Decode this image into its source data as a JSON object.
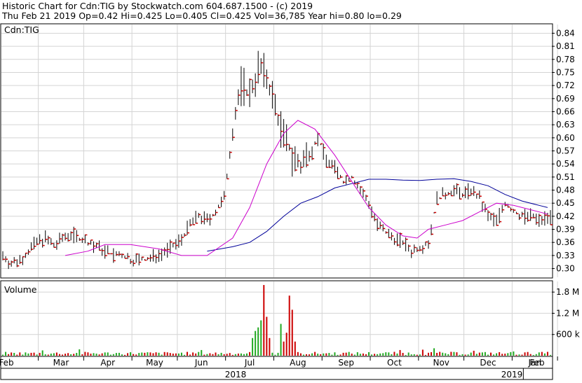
{
  "header": {
    "line1": "Historic Chart for Cdn:TIG by Stockwatch.com 604.687.1500 - (c) 2019",
    "line2": "Thu Feb 21 2019  Op=0.42  Hi=0.425  Lo=0.405  Cl=0.425  Vol=36,785  Year hi=0.80  lo=0.29"
  },
  "colors": {
    "price_bar": "#000000",
    "close_tick": "#cc0000",
    "ma_short": "#cc00cc",
    "ma_long": "#000099",
    "grid": "#d4d4d4",
    "volume_up": "#22aa22",
    "volume_down": "#cc0000",
    "frame": "#000000"
  },
  "chart_data": [
    {
      "type": "line",
      "name": "price-panel",
      "label": "Cdn:TIG",
      "ylim": [
        0.28,
        0.86
      ],
      "yticks": [
        "0.84",
        "0.81",
        "0.78",
        "0.75",
        "0.72",
        "0.69",
        "0.66",
        "0.63",
        "0.60",
        "0.57",
        "0.54",
        "0.51",
        "0.48",
        "0.45",
        "0.42",
        "0.39",
        "0.36",
        "0.33",
        "0.30"
      ],
      "grid": true,
      "x_months": [
        "Feb",
        "Mar",
        "Apr",
        "May",
        "Jun",
        "Jul",
        "Aug",
        "Sep",
        "Oct",
        "Nov",
        "Dec",
        "Jan",
        "Feb"
      ],
      "x_years": [
        "2018",
        "2019"
      ],
      "series": [],
      "close_path": [
        [
          0,
          0.33
        ],
        [
          3,
          0.31
        ],
        [
          6,
          0.32
        ],
        [
          9,
          0.34
        ],
        [
          12,
          0.36
        ],
        [
          15,
          0.37
        ],
        [
          18,
          0.35
        ],
        [
          21,
          0.37
        ],
        [
          24,
          0.38
        ],
        [
          27,
          0.37
        ],
        [
          30,
          0.36
        ],
        [
          33,
          0.35
        ],
        [
          36,
          0.34
        ],
        [
          39,
          0.33
        ],
        [
          42,
          0.33
        ],
        [
          45,
          0.32
        ],
        [
          48,
          0.32
        ],
        [
          51,
          0.32
        ],
        [
          54,
          0.33
        ],
        [
          57,
          0.34
        ],
        [
          60,
          0.35
        ],
        [
          63,
          0.37
        ],
        [
          66,
          0.4
        ],
        [
          69,
          0.42
        ],
        [
          72,
          0.41
        ],
        [
          75,
          0.43
        ],
        [
          78,
          0.46
        ],
        [
          81,
          0.62
        ],
        [
          84,
          0.72
        ],
        [
          87,
          0.7
        ],
        [
          90,
          0.76
        ],
        [
          93,
          0.74
        ],
        [
          96,
          0.67
        ],
        [
          99,
          0.6
        ],
        [
          102,
          0.56
        ],
        [
          105,
          0.53
        ],
        [
          108,
          0.57
        ],
        [
          111,
          0.6
        ],
        [
          114,
          0.55
        ],
        [
          117,
          0.53
        ],
        [
          120,
          0.5
        ],
        [
          123,
          0.51
        ],
        [
          126,
          0.48
        ],
        [
          129,
          0.45
        ],
        [
          132,
          0.4
        ],
        [
          135,
          0.38
        ],
        [
          138,
          0.37
        ],
        [
          141,
          0.36
        ],
        [
          144,
          0.34
        ],
        [
          147,
          0.35
        ],
        [
          150,
          0.36
        ],
        [
          153,
          0.46
        ],
        [
          156,
          0.47
        ],
        [
          159,
          0.48
        ],
        [
          162,
          0.47
        ],
        [
          165,
          0.48
        ],
        [
          168,
          0.46
        ],
        [
          171,
          0.42
        ],
        [
          174,
          0.41
        ],
        [
          177,
          0.45
        ],
        [
          180,
          0.43
        ],
        [
          183,
          0.42
        ],
        [
          186,
          0.42
        ],
        [
          189,
          0.41
        ],
        [
          192,
          0.42
        ]
      ],
      "ma_short": [
        [
          22,
          0.33
        ],
        [
          30,
          0.34
        ],
        [
          36,
          0.355
        ],
        [
          45,
          0.355
        ],
        [
          55,
          0.345
        ],
        [
          63,
          0.33
        ],
        [
          72,
          0.33
        ],
        [
          81,
          0.37
        ],
        [
          87,
          0.44
        ],
        [
          93,
          0.54
        ],
        [
          99,
          0.61
        ],
        [
          104,
          0.64
        ],
        [
          110,
          0.62
        ],
        [
          117,
          0.56
        ],
        [
          123,
          0.5
        ],
        [
          129,
          0.44
        ],
        [
          135,
          0.4
        ],
        [
          141,
          0.375
        ],
        [
          146,
          0.37
        ],
        [
          150,
          0.39
        ],
        [
          156,
          0.4
        ],
        [
          162,
          0.41
        ],
        [
          168,
          0.43
        ],
        [
          174,
          0.45
        ],
        [
          180,
          0.445
        ],
        [
          186,
          0.435
        ],
        [
          192,
          0.425
        ]
      ],
      "ma_long": [
        [
          72,
          0.34
        ],
        [
          81,
          0.35
        ],
        [
          87,
          0.36
        ],
        [
          93,
          0.385
        ],
        [
          99,
          0.42
        ],
        [
          105,
          0.45
        ],
        [
          111,
          0.465
        ],
        [
          117,
          0.485
        ],
        [
          123,
          0.495
        ],
        [
          129,
          0.505
        ],
        [
          135,
          0.505
        ],
        [
          141,
          0.503
        ],
        [
          147,
          0.502
        ],
        [
          153,
          0.505
        ],
        [
          159,
          0.506
        ],
        [
          165,
          0.5
        ],
        [
          171,
          0.49
        ],
        [
          177,
          0.47
        ],
        [
          183,
          0.455
        ],
        [
          189,
          0.445
        ],
        [
          192,
          0.44
        ]
      ]
    },
    {
      "type": "bar",
      "name": "volume-panel",
      "label": "Volume",
      "ylim": [
        0,
        2100000
      ],
      "yticks": [
        "1.8 M",
        "1.2 M",
        "600 k"
      ],
      "grid": true,
      "spikes": [
        [
          88,
          500000,
          "up"
        ],
        [
          89,
          700000,
          "up"
        ],
        [
          90,
          800000,
          "up"
        ],
        [
          91,
          1000000,
          "up"
        ],
        [
          92,
          2000000,
          "down"
        ],
        [
          93,
          1100000,
          "down"
        ],
        [
          94,
          500000,
          "down"
        ],
        [
          98,
          900000,
          "up"
        ],
        [
          99,
          400000,
          "down"
        ],
        [
          100,
          650000,
          "down"
        ],
        [
          101,
          1700000,
          "down"
        ],
        [
          102,
          1300000,
          "down"
        ],
        [
          103,
          400000,
          "down"
        ],
        [
          14,
          150000,
          "up"
        ],
        [
          27,
          180000,
          "up"
        ],
        [
          70,
          160000,
          "up"
        ],
        [
          140,
          160000,
          "down"
        ],
        [
          148,
          170000,
          "down"
        ],
        [
          152,
          210000,
          "up"
        ],
        [
          166,
          140000,
          "down"
        ],
        [
          180,
          120000,
          "up"
        ]
      ]
    }
  ]
}
